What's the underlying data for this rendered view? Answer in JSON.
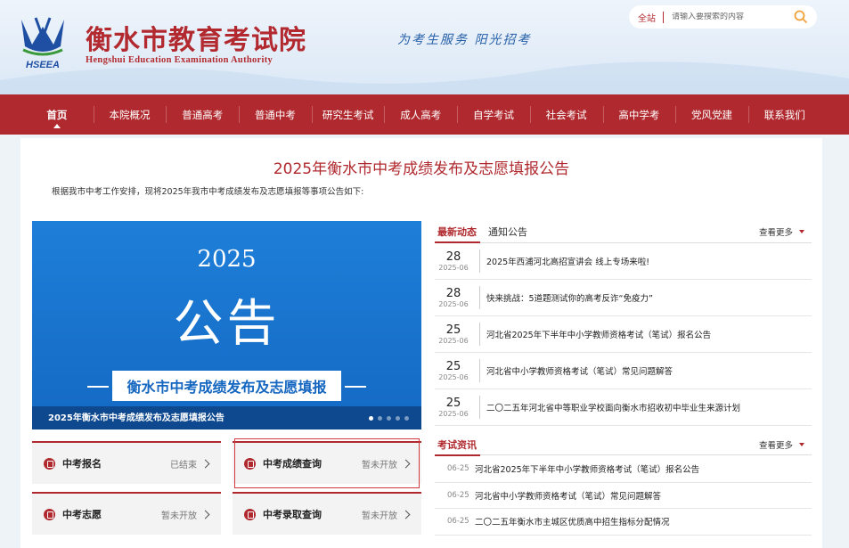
{
  "header": {
    "title_cn": "衡水市教育考试院",
    "title_en": "Hengshui Education Examination Authority",
    "logo_text": "HSEEA",
    "slogan": "为考生服务 阳光招考",
    "search": {
      "scope": "全站",
      "placeholder": "请输入要搜索的内容",
      "icon": "search-icon"
    }
  },
  "colors": {
    "brand_red": "#b0292e",
    "slide_blue": "#1a74cf"
  },
  "nav": {
    "items": [
      {
        "label": "首页",
        "active": true
      },
      {
        "label": "本院概况"
      },
      {
        "label": "普通高考"
      },
      {
        "label": "普通中考"
      },
      {
        "label": "研究生考试"
      },
      {
        "label": "成人高考"
      },
      {
        "label": "自学考试"
      },
      {
        "label": "社会考试"
      },
      {
        "label": "高中学考"
      },
      {
        "label": "党风党建"
      },
      {
        "label": "联系我们"
      }
    ]
  },
  "notice": {
    "title": "2025年衡水市中考成绩发布及志愿填报公告",
    "intro": "根据我市中考工作安排，现将2025年我市中考成绩发布及志愿填报等事项公告如下:"
  },
  "slide": {
    "year": "2025",
    "big_text": "公告",
    "banner": "衡水市中考成绩发布及志愿填报",
    "caption": "2025年衡水市中考成绩发布及志愿填报公告",
    "dots": 5,
    "active_dot": 0
  },
  "services": [
    {
      "name": "中考报名",
      "status": "已结束"
    },
    {
      "name": "中考成绩查询",
      "status": "暂未开放",
      "highlighted": true
    },
    {
      "name": "中考志愿",
      "status": "暂未开放"
    },
    {
      "name": "中考录取查询",
      "status": "暂未开放"
    }
  ],
  "news": {
    "tabs": [
      "最新动态",
      "通知公告"
    ],
    "more": "查看更多",
    "items": [
      {
        "day": "28",
        "ym": "2025-06",
        "title": "2025年西浦河北高招宣讲会 线上专场来啦!"
      },
      {
        "day": "28",
        "ym": "2025-06",
        "title": "快来挑战：5道题测试你的高考反诈“免疫力”"
      },
      {
        "day": "25",
        "ym": "2025-06",
        "title": "河北省2025年下半年中小学教师资格考试（笔试）报名公告"
      },
      {
        "day": "25",
        "ym": "2025-06",
        "title": "河北省中小学教师资格考试（笔试）常见问题解答"
      },
      {
        "day": "25",
        "ym": "2025-06",
        "title": "二〇二五年河北省中等职业学校面向衡水市招收初中毕业生来源计划"
      }
    ]
  },
  "exam": {
    "tab": "考试资讯",
    "more": "查看更多",
    "items": [
      {
        "date": "06-25",
        "title": "河北省2025年下半年中小学教师资格考试（笔试）报名公告"
      },
      {
        "date": "06-25",
        "title": "河北省中小学教师资格考试（笔试）常见问题解答"
      },
      {
        "date": "06-25",
        "title": "二〇二五年衡水市主城区优质高中招生指标分配情况"
      }
    ]
  }
}
